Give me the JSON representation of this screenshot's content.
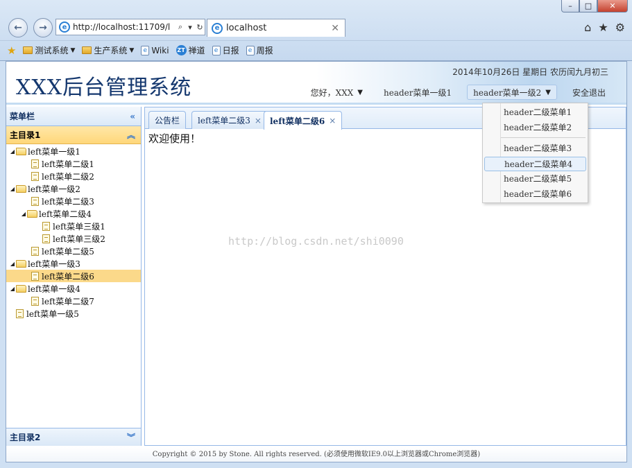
{
  "browser": {
    "address": "http://localhost:11709/l",
    "tab_title": "localhost",
    "favorites": [
      {
        "label": "测试系统",
        "type": "folder",
        "dropdown": true
      },
      {
        "label": "生产系统",
        "type": "folder",
        "dropdown": true
      },
      {
        "label": "Wiki",
        "type": "page"
      },
      {
        "label": "禅道",
        "type": "zt"
      },
      {
        "label": "日报",
        "type": "page"
      },
      {
        "label": "周报",
        "type": "page"
      }
    ]
  },
  "header": {
    "logo": "XXX后台管理系统",
    "date": "2014年10月26日 星期日 农历闰九月初三",
    "user_greeting": "您好，XXX",
    "menu1": "header菜单一级1",
    "menu2": "header菜单一级2",
    "logout": "安全退出"
  },
  "dropdown": {
    "items": [
      "header二级菜单1",
      "header二级菜单2",
      "header二级菜单3",
      "header二级菜单4",
      "header二级菜单5",
      "header二级菜单6"
    ],
    "hovered_index": 3
  },
  "sidebar": {
    "title": "菜单栏",
    "section1": "主目录1",
    "section2": "主目录2",
    "tree": [
      {
        "label": "left菜单一级1",
        "level": 0,
        "kind": "folder",
        "expanded": true
      },
      {
        "label": "left菜单二级1",
        "level": 1,
        "kind": "file"
      },
      {
        "label": "left菜单二级2",
        "level": 1,
        "kind": "file"
      },
      {
        "label": "left菜单一级2",
        "level": 0,
        "kind": "folder",
        "expanded": true
      },
      {
        "label": "left菜单二级3",
        "level": 1,
        "kind": "file"
      },
      {
        "label": "left菜单二级4",
        "level": 1,
        "kind": "folder",
        "expanded": true
      },
      {
        "label": "left菜单三级1",
        "level": 2,
        "kind": "file"
      },
      {
        "label": "left菜单三级2",
        "level": 2,
        "kind": "file"
      },
      {
        "label": "left菜单二级5",
        "level": 1,
        "kind": "file"
      },
      {
        "label": "left菜单一级3",
        "level": 0,
        "kind": "folder",
        "expanded": true
      },
      {
        "label": "left菜单二级6",
        "level": 1,
        "kind": "file",
        "selected": true
      },
      {
        "label": "left菜单一级4",
        "level": 0,
        "kind": "folder",
        "expanded": true
      },
      {
        "label": "left菜单二级7",
        "level": 1,
        "kind": "file"
      },
      {
        "label": "left菜单一级5",
        "level": 0,
        "kind": "file"
      }
    ]
  },
  "tabs": [
    {
      "label": "公告栏",
      "closable": false
    },
    {
      "label": "left菜单二级3",
      "closable": true
    },
    {
      "label": "left菜单二级6",
      "closable": true,
      "active": true
    }
  ],
  "content": {
    "welcome": "欢迎使用！",
    "watermark": "http://blog.csdn.net/shi0090"
  },
  "footer": "Copyright © 2015 by Stone. All rights reserved. (必须使用微软IE9.0以上浏览器或Chrome浏览器)"
}
